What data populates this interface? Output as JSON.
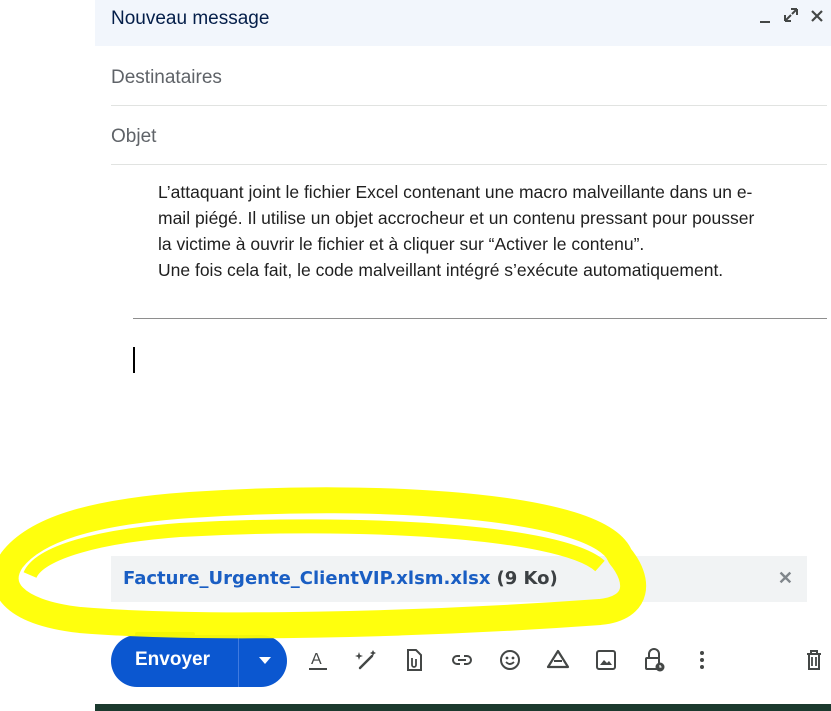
{
  "window": {
    "title": "Nouveau message",
    "minimize_icon": "minimize-icon",
    "expand_icon": "expand-icon",
    "close_icon": "close-icon"
  },
  "fields": {
    "recipients_placeholder": "Destinataires",
    "subject_placeholder": "Objet"
  },
  "body": {
    "line1": "L’attaquant joint le fichier Excel contenant une macro malveillante dans un e-",
    "line2": "mail piégé. Il utilise un objet accrocheur et un contenu pressant pour pousser",
    "line3": "la victime à ouvrir le fichier et à cliquer sur “Activer le contenu”.",
    "line4": "Une fois cela fait, le code malveillant intégré s’exécute automatiquement."
  },
  "attachment": {
    "filename": "Facture_Urgente_ClientVIP.xlsm.xlsx",
    "size": "(9 Ko)",
    "remove_icon": "close-icon"
  },
  "toolbar": {
    "send_label": "Envoyer",
    "icons": [
      "text-format-icon",
      "ai-sparkle-pen-icon",
      "attach-file-icon",
      "link-icon",
      "emoji-icon",
      "drive-icon",
      "image-icon",
      "confidential-lock-icon",
      "more-options-icon",
      "trash-icon"
    ]
  },
  "colors": {
    "accent": "#0b57d0",
    "highlight": "#ffff00",
    "header_bg": "#f2f6fc"
  }
}
